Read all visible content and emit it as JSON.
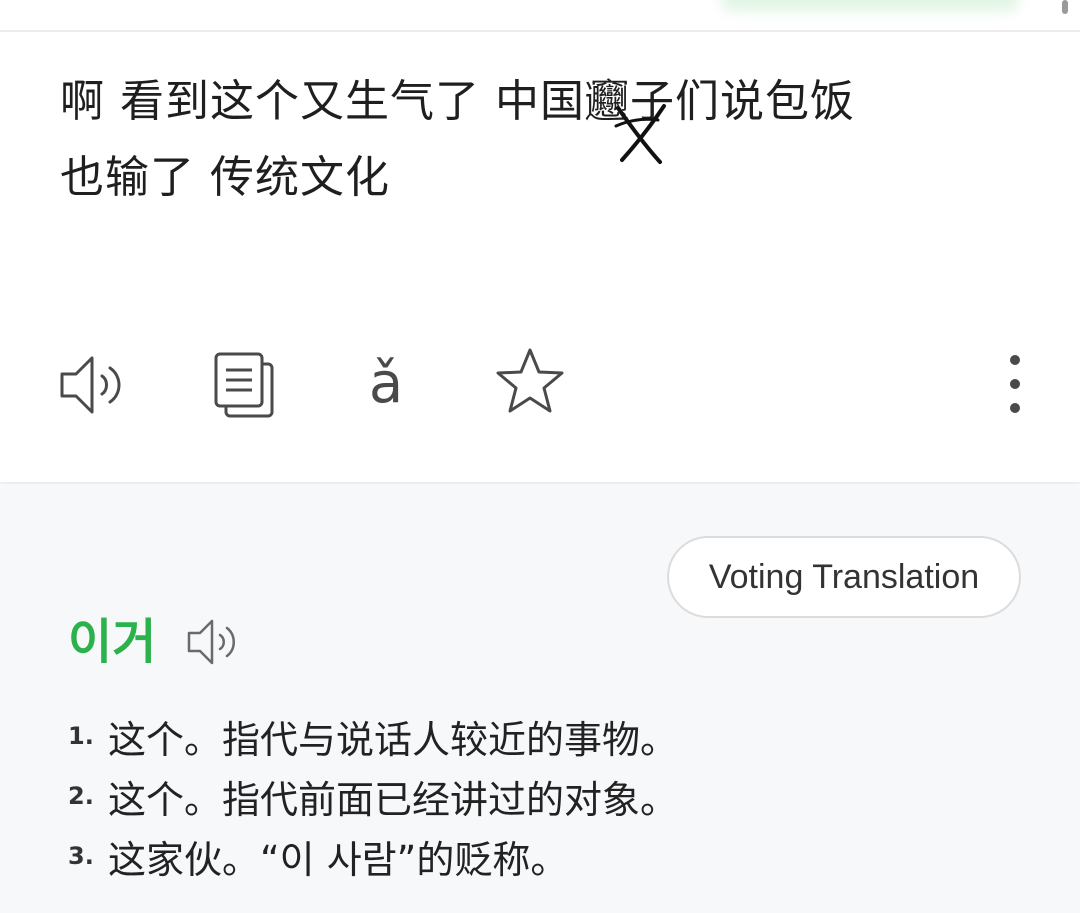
{
  "source": {
    "line1": "啊 看到这个又生气了 中国𰻝子们说包饭",
    "line2": "也输了 传统文化"
  },
  "toolbar": {
    "icons": [
      "speaker-icon",
      "copy-icon",
      "pinyin-icon",
      "star-icon",
      "more-vertical-icon"
    ],
    "pinyin_glyph": "ǎ"
  },
  "vote_button": {
    "label": "Voting Translation"
  },
  "result": {
    "headword": "이거",
    "definitions": [
      {
        "num": "1.",
        "text": "这个。指代与说话人较近的事物。"
      },
      {
        "num": "2.",
        "text": "这个。指代前面已经讲过的对象。"
      },
      {
        "num": "3.",
        "text": "这家伙。“이 사람”的贬称。"
      }
    ]
  },
  "colors": {
    "headword": "#2bb24c",
    "text": "#1f1f1f",
    "icon": "#4a4a4a",
    "background": "#f7f8fa"
  }
}
